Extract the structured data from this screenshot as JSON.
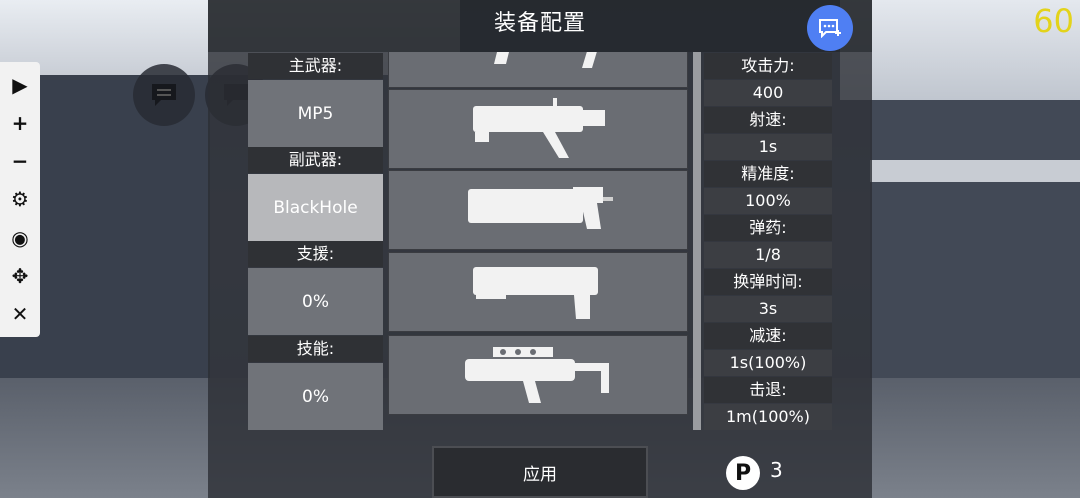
{
  "title": "装备配置",
  "fps": "60",
  "toolbar": [
    {
      "name": "play-icon",
      "glyph": "▶"
    },
    {
      "name": "plus-icon",
      "glyph": "+"
    },
    {
      "name": "minus-icon",
      "glyph": "−"
    },
    {
      "name": "gear-icon",
      "glyph": "⚙"
    },
    {
      "name": "eye-icon",
      "glyph": "◉"
    },
    {
      "name": "move-icon",
      "glyph": "✥"
    },
    {
      "name": "close-icon",
      "glyph": "✕"
    }
  ],
  "left": {
    "primary_label": "主武器:",
    "primary_value": "MP5",
    "secondary_label": "副武器:",
    "secondary_value": "BlackHole",
    "support_label": "支援:",
    "support_value": "0%",
    "skill_label": "技能:",
    "skill_value": "0%"
  },
  "weapons": [
    {
      "name": "rocket-launcher-icon"
    },
    {
      "name": "grenade-launcher-icon"
    },
    {
      "name": "heavy-cannon-icon"
    },
    {
      "name": "blaster-pistol-icon"
    },
    {
      "name": "compact-smg-icon"
    }
  ],
  "stats": {
    "attack_label": "攻击力:",
    "attack_value": "400",
    "rate_label": "射速:",
    "rate_value": "1s",
    "accuracy_label": "精准度:",
    "accuracy_value": "100%",
    "ammo_label": "弹药:",
    "ammo_value": "1/8",
    "reload_label": "换弹时间:",
    "reload_value": "3s",
    "slow_label": "减速:",
    "slow_value": "1s(100%)",
    "knockback_label": "击退:",
    "knockback_value": "1m(100%)"
  },
  "apply_label": "应用",
  "points": {
    "icon": "P",
    "value": "3"
  },
  "colors": {
    "accent_blue": "#4f7ff3",
    "fps_yellow": "#e3d31b"
  }
}
